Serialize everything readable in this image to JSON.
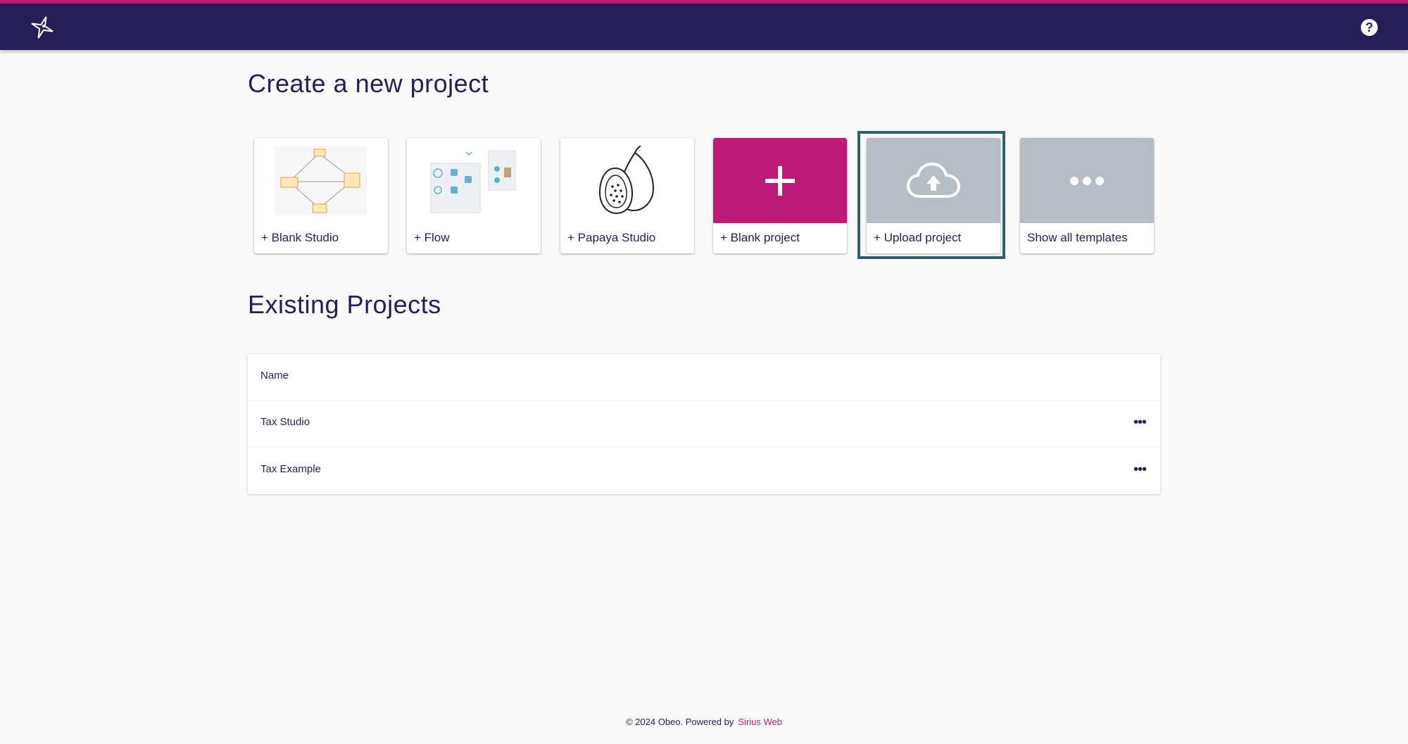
{
  "header": {
    "logo_icon": "sirius-star-logo-icon",
    "help_icon": "help-circle-icon",
    "help_glyph": "?",
    "accent_color": "#be1a78",
    "bar_color": "#261e58"
  },
  "create": {
    "title": "Create a new project",
    "cards": [
      {
        "label": "+ Blank Studio",
        "media": "diagram-thumbnail"
      },
      {
        "label": "+ Flow",
        "media": "flow-thumbnail"
      },
      {
        "label": "+ Papaya Studio",
        "media": "papaya-icon"
      },
      {
        "label": "+ Blank project",
        "media": "plus-icon",
        "glyph": "+"
      },
      {
        "label": "+ Upload project",
        "media": "cloud-upload-icon"
      },
      {
        "label": "Show all templates",
        "media": "more-horizontal-icon",
        "glyph": "•••"
      }
    ],
    "focused_card": "+ Upload project"
  },
  "existing": {
    "title": "Existing Projects",
    "table_header": "Name",
    "rows": [
      {
        "name": "Tax Studio",
        "actions_glyph": "•••"
      },
      {
        "name": "Tax Example",
        "actions_glyph": "•••"
      }
    ]
  },
  "footer": {
    "text": "© 2024 Obeo. Powered by",
    "link": "Sirius Web"
  }
}
